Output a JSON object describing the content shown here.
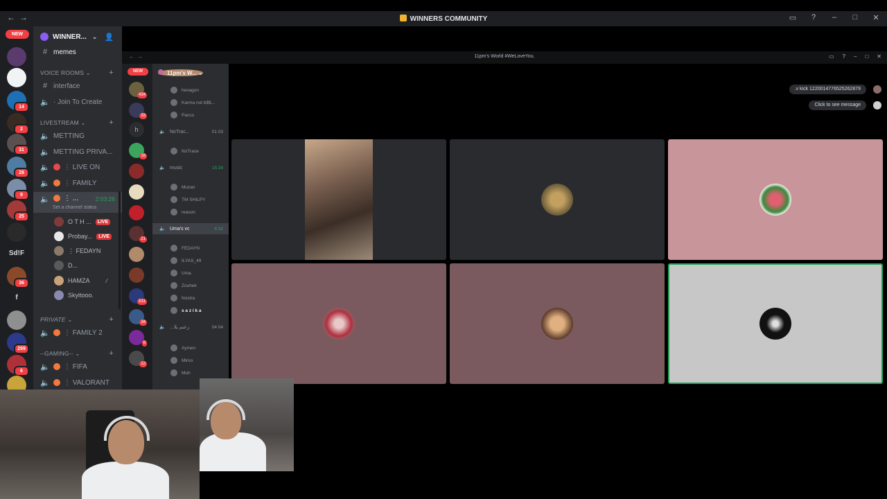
{
  "window": {
    "title": "WINNERS COMMUNITY"
  },
  "rail": {
    "new_label": "NEW",
    "server_badges": [
      "14",
      "2",
      "31",
      "28",
      "9",
      "25",
      "36",
      "299",
      "6"
    ],
    "text_servers": [
      "Sd!F",
      "f"
    ]
  },
  "sidebar": {
    "guild_name": "WINNER...",
    "top_channel": "memes",
    "categories": {
      "voice_rooms": "VOICE ROOMS",
      "livestream": "LIVESTREAM",
      "private": "PRIVATE",
      "gaming": "--GAMING--"
    },
    "channels": {
      "interface": "interface",
      "join_to_create": "· Join To Create",
      "metting": "METTING",
      "metting_priva": "METTING PRIVA...",
      "live_on": "LIVE ON",
      "family": "FAMILY",
      "active_channel": "...",
      "active_time": "2:03:26",
      "set_status": "Set a channel status",
      "family2": "FAMILY 2",
      "fifa": "FIFA",
      "valorant": "VALORANT"
    },
    "users": [
      {
        "name": "O T H ...",
        "live": "LIVE"
      },
      {
        "name": "Probay...",
        "live": "LIVE"
      },
      {
        "name": "FEDAYN",
        "live": ""
      },
      {
        "name": "D...",
        "live": ""
      },
      {
        "name": "HAMZA",
        "live": ""
      },
      {
        "name": "Skyitooo.",
        "live": ""
      }
    ]
  },
  "stream": {
    "window_title": "11pm's World #WeLoveYou.",
    "new_label": "NEW",
    "guild_name": "11pm's W...",
    "server_badges": [
      "434",
      "33",
      "16",
      "21",
      "531",
      "34",
      "6",
      "12"
    ],
    "server_letter": "h",
    "rows": {
      "hexagon": "hexagon",
      "karma": "Karma not b$$...",
      "pacco": "Pacco",
      "notrace_ch": "NoTrac...",
      "notrace_count": "01  03",
      "notrace_user": "NoTrace",
      "music": "music",
      "music_time": "15:28",
      "muzan": "Muzan",
      "tm_shilpy": "TM SHILPY",
      "reason": "reason",
      "umas_vc": "Uma's vc",
      "umas_time": "4:32",
      "fedayn": "FEDAYN",
      "ilyas": "ILYAS_49",
      "uma": "Uma",
      "zouheir": "Zouheir",
      "nostra": "Nostra",
      "sazika": "s a z i k a",
      "arabic_ch": "...رعنم يلا",
      "arabic_count": "04  04",
      "aymen": "Aymen",
      "miroo": "Miroo",
      "muh": "Muh"
    },
    "notifications": [
      ".v kick 1220014776525262879",
      "Click to see message"
    ],
    "tile_colors": [
      "#2a2b2e",
      "#2a2b2e",
      "#c8969a",
      "#7a5a5e",
      "#7a5a5e",
      "#c7c7c7"
    ]
  }
}
